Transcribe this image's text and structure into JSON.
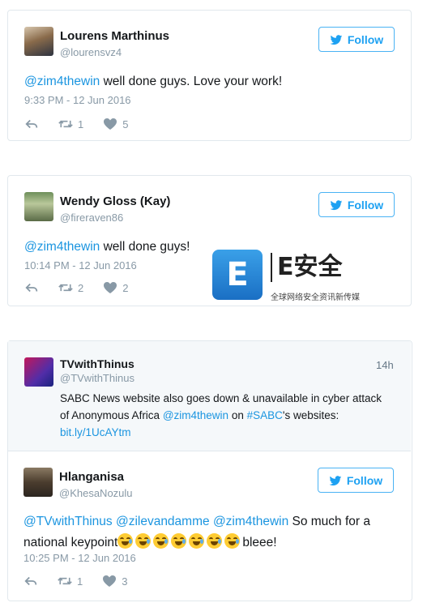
{
  "follow_label": "Follow",
  "tweets": [
    {
      "name": "Lourens Marthinus",
      "handle": "@lourensvz4",
      "mention": "@zim4thewin",
      "text": " well done guys. Love your work!",
      "timestamp": "9:33 PM - 12 Jun 2016",
      "retweets": "1",
      "likes": "5"
    },
    {
      "name": "Wendy Gloss (Kay)",
      "handle": "@fireraven86",
      "mention": "@zim4thewin",
      "text": " well done guys!",
      "timestamp": "10:14 PM - 12 Jun 2016",
      "retweets": "2",
      "likes": "2"
    },
    {
      "quoted": {
        "name": "TVwithThinus",
        "handle": "@TVwithThinus",
        "time_ago": "14h",
        "line1": "SABC News website also goes down & unavailable in cyber attack",
        "line2_a": "of Anonymous Africa ",
        "line2_mention": "@zim4thewin",
        "line2_b": " on ",
        "line2_hashtag": "#SABC",
        "line2_c": "'s websites:",
        "link": "bit.ly/1UcAYtm"
      },
      "name": "Hlanganisa",
      "handle": "@KhesaNozulu",
      "mention1": "@TVwithThinus",
      "mention2": "@zilevandamme",
      "mention3": "@zim4thewin",
      "text_a": " So much for a",
      "text_b": "national keypoint",
      "text_c": "bleee!",
      "timestamp": "10:25 PM - 12 Jun 2016",
      "retweets": "1",
      "likes": "3"
    }
  ],
  "watermark": {
    "tile_letter": "E",
    "main": "E安全",
    "sub": "全球网络安全资讯新传媒"
  },
  "colors": {
    "link": "#1b95e0",
    "follow": "#1da1f2",
    "muted": "#8899a6"
  },
  "icons": [
    "reply-icon",
    "retweet-icon",
    "like-icon",
    "twitter-bird-icon"
  ]
}
